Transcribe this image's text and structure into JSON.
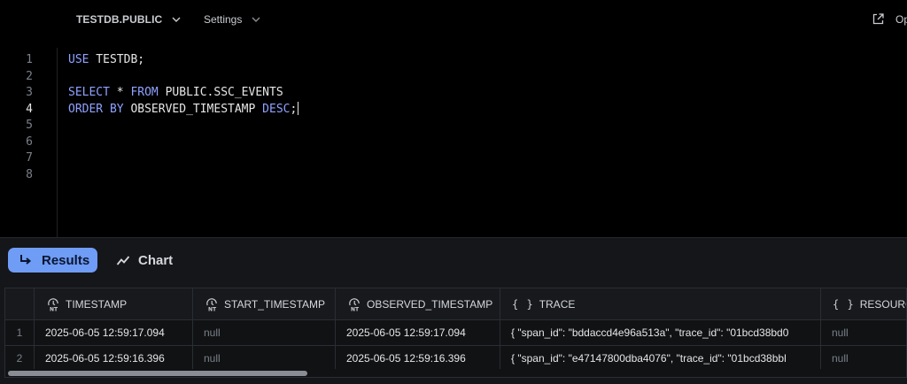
{
  "toolbar": {
    "database_label": "TESTDB.PUBLIC",
    "settings_label": "Settings",
    "open_label": "Op"
  },
  "editor": {
    "lines": [
      {
        "number": "1",
        "tokens": [
          {
            "t": "USE",
            "kw": true
          },
          {
            "t": " TESTDB;",
            "kw": false
          }
        ]
      },
      {
        "number": "2",
        "tokens": []
      },
      {
        "number": "3",
        "tokens": [
          {
            "t": "SELECT",
            "kw": true
          },
          {
            "t": " * ",
            "kw": false
          },
          {
            "t": "FROM",
            "kw": true
          },
          {
            "t": " PUBLIC.SSC_EVENTS",
            "kw": false
          }
        ]
      },
      {
        "number": "4",
        "tokens": [
          {
            "t": "ORDER BY",
            "kw": true
          },
          {
            "t": " OBSERVED_TIMESTAMP ",
            "kw": false
          },
          {
            "t": "DESC",
            "kw": true
          },
          {
            "t": ";",
            "kw": false
          }
        ],
        "active": true
      },
      {
        "number": "5",
        "tokens": []
      },
      {
        "number": "6",
        "tokens": []
      },
      {
        "number": "7",
        "tokens": []
      },
      {
        "number": "8",
        "tokens": []
      }
    ]
  },
  "results": {
    "tab_results_label": "Results",
    "tab_chart_label": "Chart",
    "active_tab": "Results"
  },
  "grid": {
    "columns": [
      {
        "label": "TIMESTAMP",
        "icon": "timestamp-ntz-icon"
      },
      {
        "label": "START_TIMESTAMP",
        "icon": "timestamp-ntz-icon"
      },
      {
        "label": "OBSERVED_TIMESTAMP",
        "icon": "timestamp-ntz-icon"
      },
      {
        "label": "TRACE",
        "icon": "object-braces-icon"
      },
      {
        "label": "RESOURCE",
        "icon": "object-braces-icon"
      }
    ],
    "rows": [
      {
        "n": "1",
        "timestamp": "2025-06-05 12:59:17.094",
        "start_timestamp": "null",
        "observed_timestamp": "2025-06-05 12:59:17.094",
        "trace": "{  \"span_id\": \"bddaccd4e96a513a\",  \"trace_id\": \"01bcd38bd0",
        "resource": "null"
      },
      {
        "n": "2",
        "timestamp": "2025-06-05 12:59:16.396",
        "start_timestamp": "null",
        "observed_timestamp": "2025-06-05 12:59:16.396",
        "trace": "{  \"span_id\": \"e47147800dba4076\",  \"trace_id\": \"01bcd38bbl",
        "resource": "null"
      }
    ]
  },
  "colors": {
    "background": "#000000",
    "panel": "#141619",
    "accent": "#6f9cf5",
    "keyword": "#8fa2ff"
  }
}
